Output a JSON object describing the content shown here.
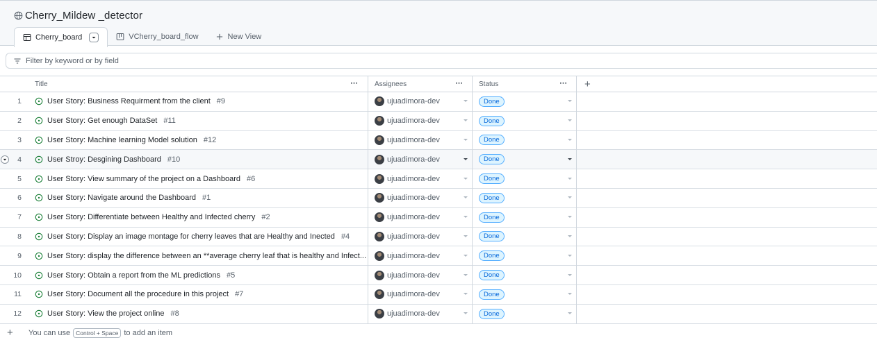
{
  "project": {
    "title": "Cherry_Mildew _detector",
    "icon": "globe-icon"
  },
  "tabs": [
    {
      "label": "Cherry_board",
      "icon": "table-icon",
      "active": true
    },
    {
      "label": "VCherry_board_flow",
      "icon": "board-icon",
      "active": false
    },
    {
      "label": "New View",
      "icon": "plus-icon",
      "active": false
    }
  ],
  "filter": {
    "placeholder": "Filter by keyword or by field",
    "icon": "filter-icon"
  },
  "columns": {
    "title": "Title",
    "assignees": "Assignees",
    "status": "Status",
    "menu": "⋯",
    "add": "+"
  },
  "rows": [
    {
      "n": "1",
      "title": "User Story: Business Requirment from the client",
      "num": "#9",
      "assignee": "ujuadimora-dev",
      "status": "Done"
    },
    {
      "n": "2",
      "title": "User Story: Get enough DataSet",
      "num": "#11",
      "assignee": "ujuadimora-dev",
      "status": "Done"
    },
    {
      "n": "3",
      "title": "User Story: Machine learning Model solution",
      "num": "#12",
      "assignee": "ujuadimora-dev",
      "status": "Done"
    },
    {
      "n": "4",
      "title": "User Stroy: Desgining Dashboard",
      "num": "#10",
      "assignee": "ujuadimora-dev",
      "status": "Done"
    },
    {
      "n": "5",
      "title": "User Story: View summary of the project on a Dashboard",
      "num": "#6",
      "assignee": "ujuadimora-dev",
      "status": "Done"
    },
    {
      "n": "6",
      "title": "User Story: Navigate around the Dashboard",
      "num": "#1",
      "assignee": "ujuadimora-dev",
      "status": "Done"
    },
    {
      "n": "7",
      "title": "User Story: Differentiate between Healthy and Infected cherry",
      "num": "#2",
      "assignee": "ujuadimora-dev",
      "status": "Done"
    },
    {
      "n": "8",
      "title": "User Story: Display an image montage for cherry leaves that are Healthy and Inected",
      "num": "#4",
      "assignee": "ujuadimora-dev",
      "status": "Done"
    },
    {
      "n": "9",
      "title": "User Story: display the difference between an **average cherry leaf that is healthy and Infect...",
      "num": "#3",
      "assignee": "ujuadimora-dev",
      "status": "Done"
    },
    {
      "n": "10",
      "title": "User Story: Obtain a report from the ML predictions",
      "num": "#5",
      "assignee": "ujuadimora-dev",
      "status": "Done"
    },
    {
      "n": "11",
      "title": "User Story: Document all the procedure in this project",
      "num": "#7",
      "assignee": "ujuadimora-dev",
      "status": "Done"
    },
    {
      "n": "12",
      "title": "User Story: View the project online",
      "num": "#8",
      "assignee": "ujuadimora-dev",
      "status": "Done"
    }
  ],
  "hover_row_index": 3,
  "footer": {
    "plus": "+",
    "before": "You can use",
    "shortcut": "Control + Space",
    "after": "to add an item"
  },
  "colors": {
    "accent": "#0969da",
    "badge_bg": "#ddf4ff",
    "issue_open": "#1a7f37",
    "border": "#d0d7de"
  }
}
